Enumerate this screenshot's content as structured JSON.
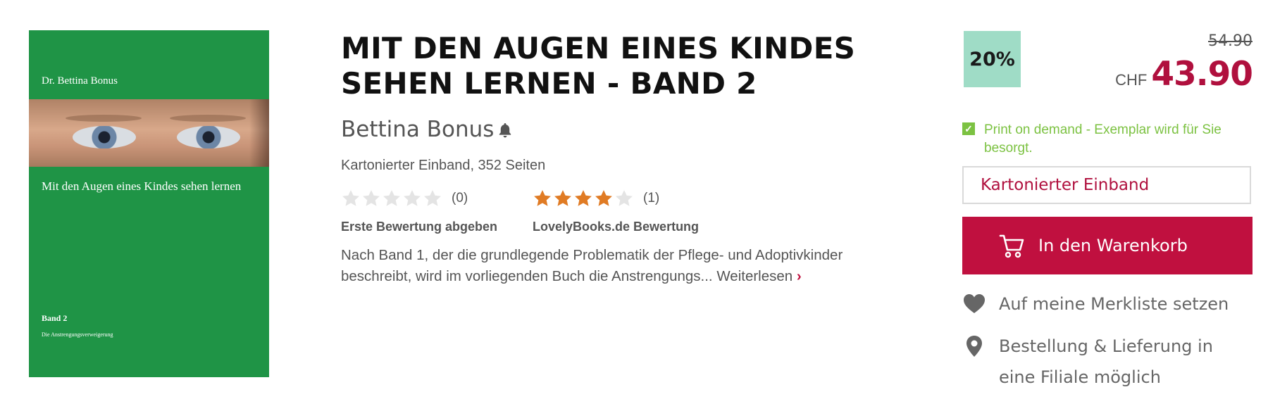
{
  "cover": {
    "author": "Dr. Bettina Bonus",
    "subtitle": "Mit den Augen eines Kindes sehen lernen",
    "band": "Band 2",
    "band_subtitle": "Die Anstrengungsverweigerung",
    "background_color": "#1f9446"
  },
  "product": {
    "title": "MIT DEN AUGEN EINES KINDES SEHEN LERNEN - BAND 2",
    "author": "Bettina Bonus",
    "author_follow_icon": "bell-icon",
    "format_info": "Kartonierter Einband, 352 Seiten"
  },
  "ratings": {
    "own": {
      "stars": 0,
      "max": 5,
      "count": "(0)",
      "caption": "Erste Bewertung abgeben"
    },
    "lovelybooks": {
      "stars": 4,
      "max": 5,
      "count": "(1)",
      "caption": "LovelyBooks.de Bewertung"
    }
  },
  "description": {
    "text": "Nach Band 1, der die grundlegende Problematik der Pflege- und Adoptivkinder beschreibt, wird im vorliegenden Buch die Anstrengungs...",
    "more_label": "Weiterlesen",
    "more_icon": "chevron-right-icon"
  },
  "buy_box": {
    "discount": "20%",
    "old_price": "54.90",
    "currency": "CHF",
    "price": "43.90",
    "availability": "Print on demand - Exemplar wird für Sie besorgt.",
    "format_selected": "Kartonierter Einband",
    "cart_button": "In den Warenkorb",
    "wishlist_label": "Auf meine Merkliste setzen",
    "store_label": "Bestellung & Lieferung in eine Filiale möglich"
  },
  "colors": {
    "accent": "#c0103f",
    "price": "#b0103e",
    "availability": "#7cc242",
    "discount_badge": "#9fdcc6",
    "star_filled": "#e07b24",
    "star_empty": "#e4e4e4"
  },
  "icons": {
    "cart": "shopping-cart-icon",
    "wishlist": "heart-icon",
    "store": "location-pin-icon",
    "availability": "checkbox-icon"
  }
}
